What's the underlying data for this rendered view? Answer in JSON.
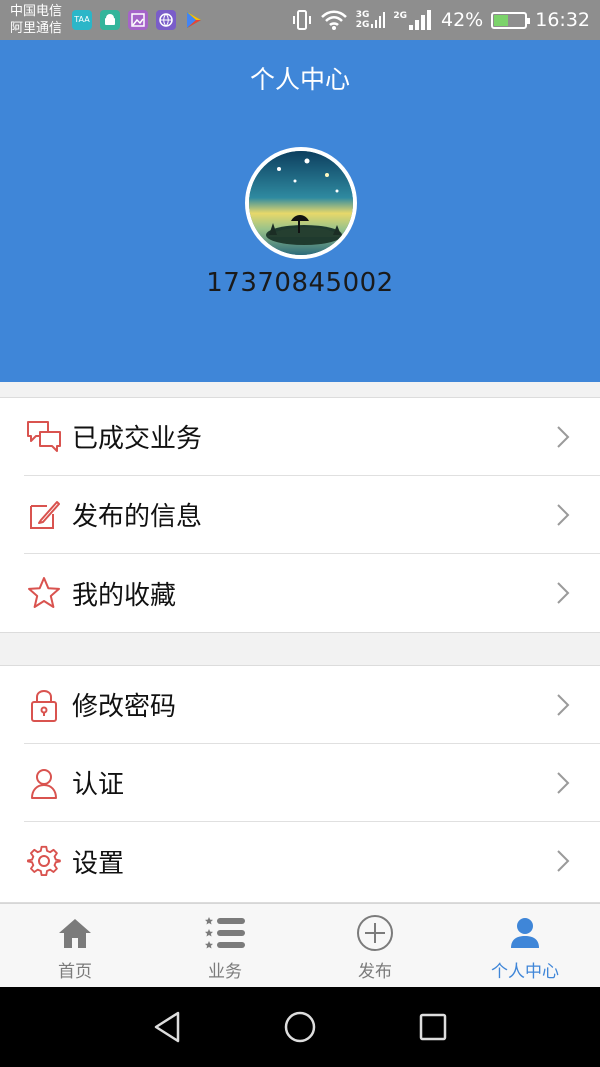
{
  "status_bar": {
    "carrier_line1": "中国电信",
    "carrier_line2": "阿里通信",
    "notification_icons": [
      {
        "icon": "app-icon",
        "text": "TAA",
        "color": "#2bb6c8"
      },
      {
        "icon": "android-icon",
        "text": "",
        "color": "#33b59b"
      },
      {
        "icon": "gallery-icon",
        "text": "",
        "color": "#a564c9"
      },
      {
        "icon": "browser-icon",
        "text": "",
        "color": "#7a5dc9"
      },
      {
        "icon": "play-store-icon",
        "text": "",
        "color": "#e0e0e0"
      }
    ],
    "net_top": "3G",
    "net_bottom": "2G",
    "net_2": "2G",
    "battery_percent": "42%",
    "battery_level": 0.42,
    "time": "16:32"
  },
  "header": {
    "title": "个人中心",
    "phone": "17370845002",
    "bg_color": "#3f86d8"
  },
  "menu_group_1": [
    {
      "label": "已成交业务",
      "icon": "chat-bubbles-icon"
    },
    {
      "label": "发布的信息",
      "icon": "edit-icon"
    },
    {
      "label": "我的收藏",
      "icon": "star-icon"
    }
  ],
  "menu_group_2": [
    {
      "label": "修改密码",
      "icon": "lock-icon"
    },
    {
      "label": "认证",
      "icon": "user-outline-icon"
    },
    {
      "label": "设置",
      "icon": "gear-icon"
    }
  ],
  "bottom_nav": [
    {
      "label": "首页",
      "icon": "home-icon",
      "active": false
    },
    {
      "label": "业务",
      "icon": "list-icon",
      "active": false
    },
    {
      "label": "发布",
      "icon": "add-circle-icon",
      "active": false
    },
    {
      "label": "个人中心",
      "icon": "person-icon",
      "active": true
    }
  ],
  "colors": {
    "accent": "#3f86d8",
    "icon_red": "#d9534f",
    "inactive": "#7b7b7b"
  }
}
